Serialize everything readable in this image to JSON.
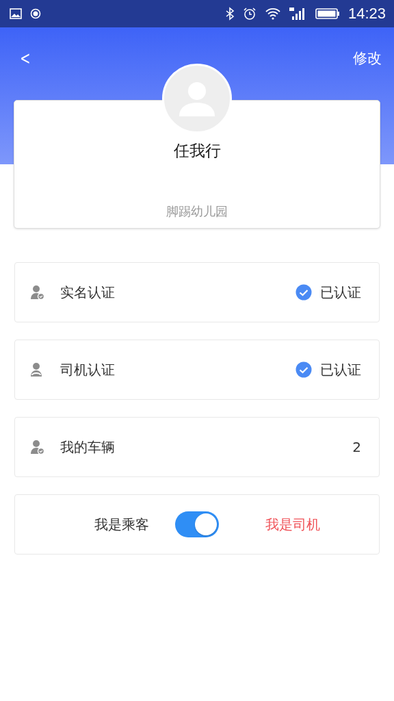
{
  "status_bar": {
    "time": "14:23"
  },
  "header": {
    "back": "<",
    "action": "修改"
  },
  "profile": {
    "name": "任我行",
    "organization": "脚踢幼儿园"
  },
  "rows": [
    {
      "kind": "status",
      "label": "实名认证",
      "verified": true,
      "value": "已认证"
    },
    {
      "kind": "status",
      "label": "司机认证",
      "verified": true,
      "value": "已认证"
    },
    {
      "kind": "count",
      "label": "我的车辆",
      "value": "2"
    }
  ],
  "role_switch": {
    "passenger": "我是乘客",
    "driver": "我是司机",
    "on": true
  }
}
